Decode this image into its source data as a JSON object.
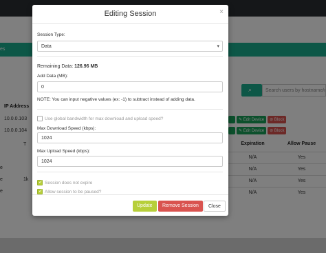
{
  "background": {
    "nav_fragment": "es",
    "search_placeholder": "Search users by hostname/m",
    "ip_header": "IP Address",
    "ip_rows": [
      "10.0.0.103",
      "10.0.0.104"
    ],
    "edit_device_label": "Edit Device",
    "block_label": "Block",
    "table_headers": [
      "Expiration",
      "Allow Pause"
    ],
    "table_rows": [
      {
        "expiration": "N/A",
        "allow_pause": "Yes"
      },
      {
        "expiration": "N/A",
        "allow_pause": "Yes"
      },
      {
        "expiration": "N/A",
        "allow_pause": "Yes"
      },
      {
        "expiration": "N/A",
        "allow_pause": "Yes"
      }
    ],
    "left_fragments": [
      "e",
      "e",
      "e"
    ],
    "mid_fragments": [
      "1k"
    ],
    "col_t": "T"
  },
  "modal": {
    "title": "Editing Session",
    "close_glyph": "×",
    "session_type_label": "Session Type:",
    "session_type_value": "Data",
    "remaining_label": "Remaining Data:",
    "remaining_value": "126.96 MB",
    "add_data_label": "Add Data (MB):",
    "add_data_value": "0",
    "note": "NOTE: You can input negative values (ex: -1) to subtract instead of adding data.",
    "use_global_label": "Use global bandwidth for max download and upload speed?",
    "max_download_label": "Max Download Speed (kbps):",
    "max_download_value": "1024",
    "max_upload_label": "Max Upload Speed (kbps):",
    "max_upload_value": "1024",
    "session_not_expire_label": "Session does not expire",
    "allow_pause_label": "Allow session to be paused?",
    "checks": {
      "use_global": false,
      "session_not_expire": true,
      "allow_pause": true
    },
    "buttons": {
      "update": "Update",
      "remove": "Remove Session",
      "close": "Close"
    }
  },
  "colors": {
    "teal": "#1aae8f",
    "lime": "#b7cf3a",
    "danger": "#d9534f",
    "success": "#18a058"
  }
}
